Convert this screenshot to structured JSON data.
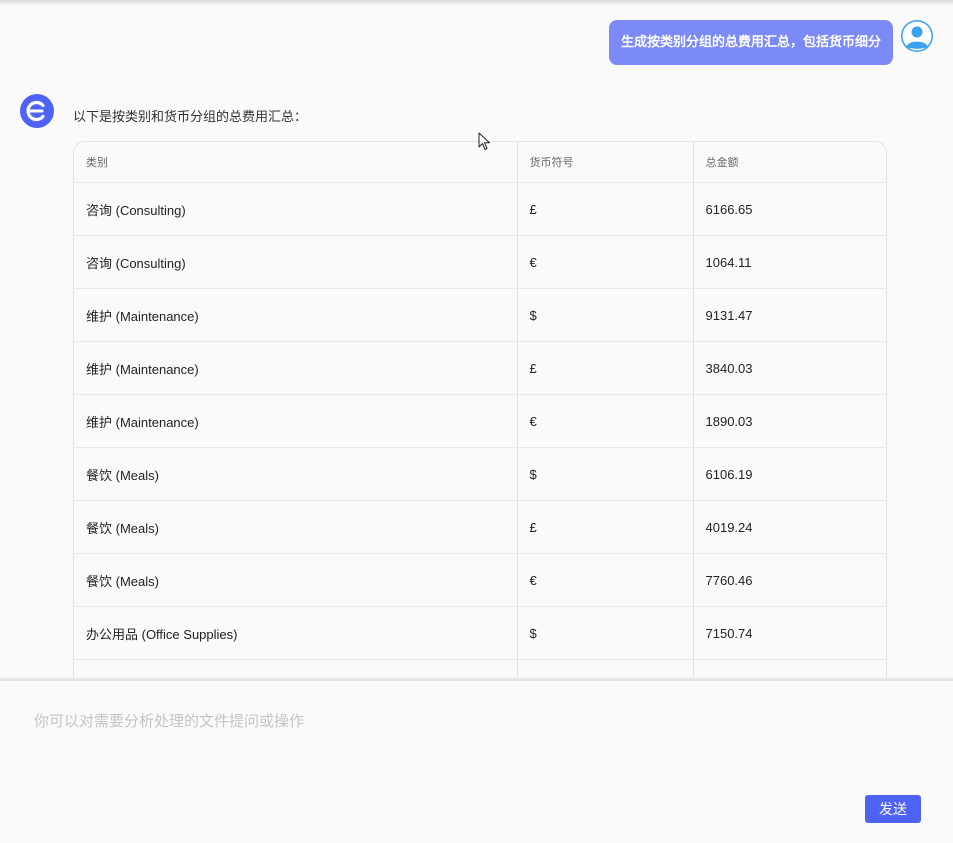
{
  "user_message": "生成按类别分组的总费用汇总，包括货币细分",
  "bot_message": {
    "intro": "以下是按类别和货币分组的总费用汇总：",
    "table": {
      "headers": [
        "类别",
        "货币符号",
        "总金额"
      ],
      "rows": [
        [
          "咨询 (Consulting)",
          "£",
          "6166.65"
        ],
        [
          "咨询 (Consulting)",
          "€",
          "1064.11"
        ],
        [
          "维护 (Maintenance)",
          "$",
          "9131.47"
        ],
        [
          "维护 (Maintenance)",
          "£",
          "3840.03"
        ],
        [
          "维护 (Maintenance)",
          "€",
          "1890.03"
        ],
        [
          "餐饮 (Meals)",
          "$",
          "6106.19"
        ],
        [
          "餐饮 (Meals)",
          "£",
          "4019.24"
        ],
        [
          "餐饮 (Meals)",
          "€",
          "7760.46"
        ],
        [
          "办公用品 (Office Supplies)",
          "$",
          "7150.74"
        ],
        [
          "",
          "",
          ""
        ]
      ]
    }
  },
  "input": {
    "placeholder": "你可以对需要分析处理的文件提问或操作"
  },
  "send_label": "发送",
  "colors": {
    "user_bubble": "#7b8af6",
    "send_button": "#4e62f5",
    "bot_avatar": "#4e62f5",
    "user_avatar": "#3aa0f0"
  },
  "icons": {
    "user_avatar": "user-avatar-icon",
    "bot_avatar": "bot-logo-icon",
    "cursor": "mouse-cursor-icon"
  }
}
